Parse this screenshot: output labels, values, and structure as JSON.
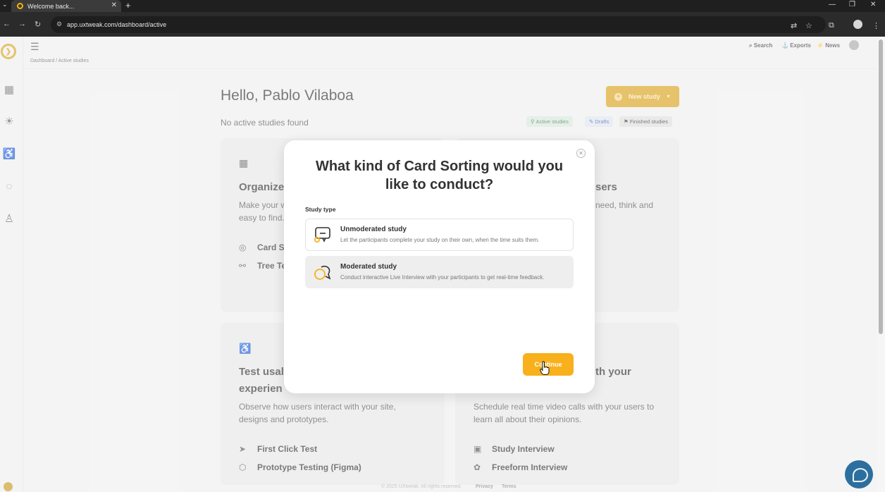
{
  "browser": {
    "tab_title": "Welcome back...",
    "url": "app.uxtweak.com/dashboard/active"
  },
  "topnav": {
    "search": "Search",
    "exports": "Exports",
    "news": "News"
  },
  "breadcrumb": "Dashboard / Active studies",
  "main": {
    "greeting": "Hello, Pablo Vilaboa",
    "no_studies": "No active studies found",
    "new_study": "New study",
    "filters": {
      "active": "Active studies",
      "drafts": "Drafts",
      "finished": "Finished studies"
    }
  },
  "cards": {
    "organize": {
      "title": "Organize",
      "text_1": "Make your w",
      "text_2": "easy to find.",
      "link_1": "Card S",
      "link_2": "Tree Te"
    },
    "users": {
      "title": "sers",
      "text_1": "need, think and"
    },
    "usability": {
      "title_1": "Test usal",
      "title_2": "experien",
      "text_1": "Observe how users interact with your site,",
      "text_2": "designs and prototypes.",
      "link_1": "First Click Test",
      "link_2": "Prototype Testing (Figma)"
    },
    "interview": {
      "title": "th your",
      "text_1": "Schedule real time video calls with your users to",
      "text_2": "learn all about their opinions.",
      "link_1": "Study Interview",
      "link_2": "Freeform Interview"
    }
  },
  "footer": {
    "copyright": "© 2025 UXtweak. All rights reserved.",
    "privacy": "Privacy",
    "terms": "Terms"
  },
  "modal": {
    "title": "What kind of Card Sorting would you like to conduct?",
    "label": "Study type",
    "options": [
      {
        "title": "Unmoderated study",
        "desc": "Let the participants complete your study on their own, when the time suits them."
      },
      {
        "title": "Moderated study",
        "desc": "Conduct interactive Live Interview with your participants to get real-time feedback."
      }
    ],
    "continue": "Continue"
  },
  "colors": {
    "accent": "#f8b01c",
    "brand": "#d9a21b",
    "chat": "#2c6f9e"
  }
}
